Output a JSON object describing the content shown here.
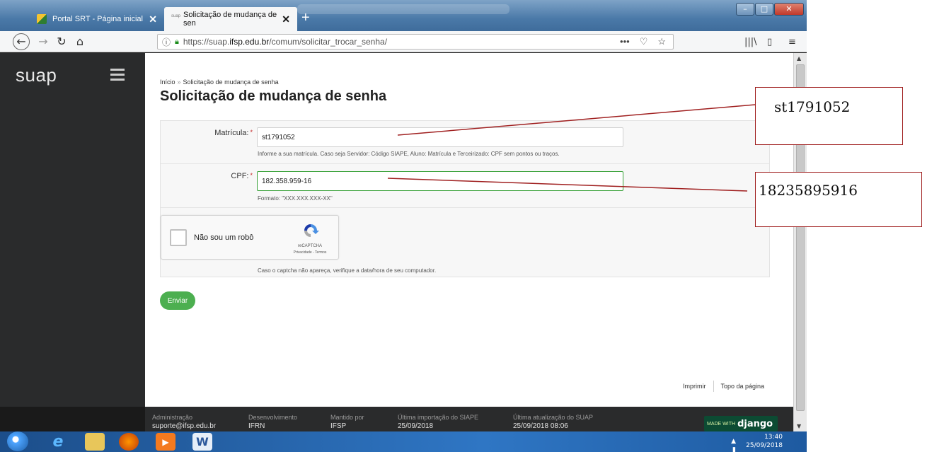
{
  "browser": {
    "tabs": [
      {
        "label": "Portal SRT - Página inicial",
        "active": false
      },
      {
        "label": "Solicitação de mudança de sen",
        "active": true,
        "favicon_text": "suap"
      }
    ],
    "url_prefix": "https://suap.",
    "url_host": "ifsp.edu.br",
    "url_path": "/comum/solicitar_trocar_senha/",
    "icons": [
      "back-icon",
      "forward-icon",
      "reload-icon",
      "home-icon",
      "info-icon",
      "lock-icon",
      "more-icon",
      "pocket-icon",
      "bookmark-star-icon",
      "library-icon",
      "sidebar-icon",
      "menu-icon"
    ]
  },
  "sidebar": {
    "logo": "suap"
  },
  "breadcrumb": {
    "home": "Início",
    "sep": "»",
    "current": "Solicitação de mudança de senha"
  },
  "page": {
    "title": "Solicitação de mudança de senha"
  },
  "form": {
    "matricula": {
      "label": "Matrícula:",
      "required": "*",
      "value": "st1791052",
      "help": "Informe a sua matrícula. Caso seja Servidor: Código SIAPE, Aluno: Matrícula e Terceirizado: CPF sem pontos ou traços."
    },
    "cpf": {
      "label": "CPF:",
      "required": "*",
      "value": "182.358.959-16",
      "help": "Formato: \"XXX.XXX.XXX-XX\""
    },
    "captcha": {
      "label": "Não sou um robô",
      "brand": "reCAPTCHA",
      "links": "Privacidade - Termos",
      "help": "Caso o captcha não apareça, verifique a data/hora de seu computador."
    },
    "submit": "Enviar"
  },
  "page_links": {
    "print": "Imprimir",
    "top": "Topo da página"
  },
  "footer": {
    "cols": [
      {
        "title": "Administração",
        "value": "suporte@ifsp.edu.br"
      },
      {
        "title": "Desenvolvimento",
        "value": "IFRN"
      },
      {
        "title": "Mantido por",
        "value": "IFSP"
      },
      {
        "title": "Última importação do SIAPE",
        "value": "25/09/2018"
      },
      {
        "title": "Última atualização do SUAP",
        "value": "25/09/2018 08:06"
      }
    ],
    "badge_made_with": "MADE WITH",
    "badge_django": "django"
  },
  "taskbar": {
    "time": "13:40",
    "date": "25/09/2018",
    "apps": [
      "windows-start-icon",
      "internet-explorer-icon",
      "file-explorer-icon",
      "firefox-icon",
      "media-player-icon",
      "word-icon"
    ]
  },
  "annotations": {
    "matricula_note": "st1791052",
    "cpf_note": "18235895916",
    "line_color": "#a02020"
  },
  "colors": {
    "accent_green": "#4caf50",
    "sidebar": "#2a2b2c",
    "required": "#c62828"
  }
}
